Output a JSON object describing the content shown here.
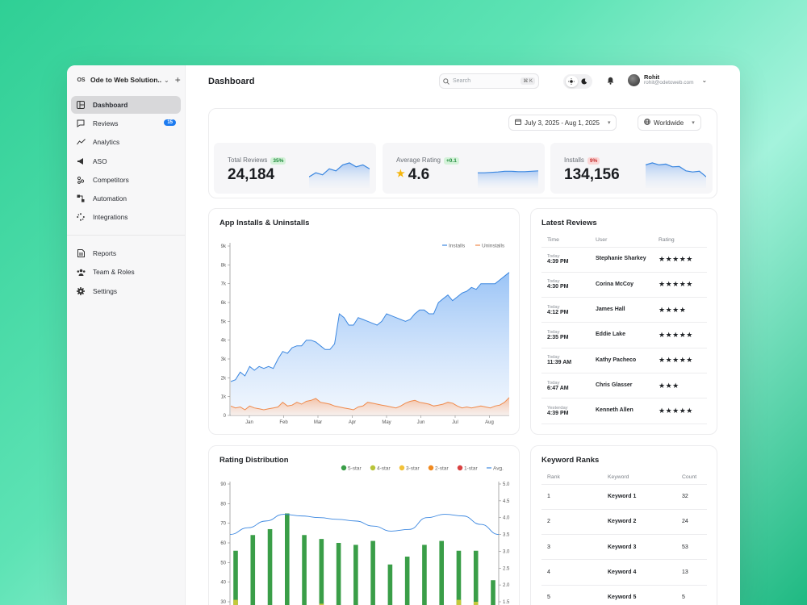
{
  "sidebar": {
    "org_badge": "OS",
    "org_name": "Ode to Web Solution...",
    "items": [
      {
        "label": "Dashboard"
      },
      {
        "label": "Reviews",
        "badge": "15"
      },
      {
        "label": "Analytics"
      },
      {
        "label": "ASO"
      },
      {
        "label": "Competitors"
      },
      {
        "label": "Automation"
      },
      {
        "label": "Integrations"
      }
    ],
    "bottom_items": [
      {
        "label": "Reports"
      },
      {
        "label": "Team & Roles"
      },
      {
        "label": "Settings"
      }
    ]
  },
  "header": {
    "title": "Dashboard",
    "search_placeholder": "Search",
    "search_shortcut": "⌘ K",
    "user_name": "Rohit",
    "user_email": "rohit@odetoweb.com"
  },
  "filters": {
    "date_range": "July 3, 2025 - Aug 1, 2025",
    "region": "Worldwide"
  },
  "stats": [
    {
      "label": "Total Reviews",
      "badge": "35%",
      "value": "24,184",
      "trend": [
        2,
        3,
        2.5,
        4,
        3.5,
        5,
        5.5,
        4.5,
        5,
        4
      ]
    },
    {
      "label": "Average Rating",
      "badge": "+0.1",
      "value": "4.6",
      "trend": [
        3,
        3,
        3.1,
        3.2,
        3.4,
        3.4,
        3.3,
        3.3,
        3.4,
        3.5
      ]
    },
    {
      "label": "Installs",
      "badge": "9%",
      "value": "134,156",
      "trend": [
        5,
        5.5,
        5,
        5.2,
        4.5,
        4.6,
        3.5,
        3.2,
        3.4,
        2
      ]
    }
  ],
  "installs_chart": {
    "title": "App Installs & Uninstalls",
    "legend": [
      "Installs",
      "Uninstalls"
    ],
    "colors": {
      "installs": "#3b87e0",
      "uninstalls": "#ef8a4c"
    },
    "y_ticks": [
      "0",
      "1k",
      "2k",
      "3k",
      "4k",
      "5k",
      "6k",
      "7k",
      "8k",
      "9k"
    ],
    "x_ticks": [
      "Jan",
      "Feb",
      "Mar",
      "Apr",
      "May",
      "Jun",
      "Jul",
      "Aug"
    ],
    "chart_data": {
      "type": "area",
      "ylim": [
        0,
        9000
      ],
      "series": [
        {
          "name": "Installs",
          "values": [
            1800,
            1900,
            2300,
            2100,
            2600,
            2400,
            2600,
            2500,
            2600,
            2500,
            3000,
            3400,
            3300,
            3600,
            3700,
            3700,
            4000,
            4000,
            3900,
            3700,
            3500,
            3500,
            3800,
            5400,
            5200,
            4800,
            4800,
            5200,
            5100,
            5000,
            4900,
            4800,
            5000,
            5400,
            5300,
            5200,
            5100,
            5000,
            5100,
            5400,
            5600,
            5600,
            5400,
            5400,
            6000,
            6200,
            6400,
            6100,
            6300,
            6500,
            6600,
            6800,
            6700,
            7000,
            7000,
            7000,
            7000,
            7200,
            7400,
            7600
          ]
        },
        {
          "name": "Uninstalls",
          "values": [
            500,
            400,
            450,
            300,
            500,
            400,
            350,
            300,
            350,
            400,
            450,
            700,
            500,
            550,
            700,
            600,
            750,
            800,
            900,
            700,
            650,
            600,
            500,
            450,
            400,
            350,
            300,
            450,
            500,
            700,
            650,
            600,
            550,
            500,
            450,
            400,
            500,
            650,
            750,
            800,
            700,
            650,
            600,
            500,
            550,
            600,
            700,
            650,
            500,
            400,
            450,
            400,
            450,
            500,
            450,
            400,
            500,
            550,
            700,
            950
          ]
        }
      ]
    }
  },
  "latest_reviews": {
    "title": "Latest Reviews",
    "columns": [
      "Time",
      "User",
      "Rating"
    ],
    "rows": [
      {
        "day": "Today",
        "time": "4:39 PM",
        "user": "Stephanie Sharkey",
        "stars": 5
      },
      {
        "day": "Today",
        "time": "4:30 PM",
        "user": "Corina McCoy",
        "stars": 5
      },
      {
        "day": "Today",
        "time": "4:12 PM",
        "user": "James Hall",
        "stars": 4
      },
      {
        "day": "Today",
        "time": "2:35 PM",
        "user": "Eddie Lake",
        "stars": 5
      },
      {
        "day": "Today",
        "time": "11:39 AM",
        "user": "Kathy Pacheco",
        "stars": 5
      },
      {
        "day": "Today",
        "time": "6:47 AM",
        "user": "Chris Glasser",
        "stars": 3
      },
      {
        "day": "Yesterday",
        "time": "4:39 PM",
        "user": "Kenneth Allen",
        "stars": 5
      }
    ]
  },
  "rating_distribution": {
    "title": "Rating Distribution",
    "legend": [
      {
        "label": "5-star",
        "color": "#3a9e48"
      },
      {
        "label": "4-star",
        "color": "#b8c43a"
      },
      {
        "label": "3-star",
        "color": "#f2c23a"
      },
      {
        "label": "2-star",
        "color": "#f0891f"
      },
      {
        "label": "1-star",
        "color": "#d94141"
      },
      {
        "label": "Avg.",
        "color": "#3b87e0"
      }
    ],
    "y_ticks": [
      "30",
      "40",
      "50",
      "60",
      "70",
      "80",
      "90"
    ],
    "y2_ticks": [
      "1.5",
      "2.0",
      "2.5",
      "3.0",
      "3.5",
      "4.0",
      "4.5",
      "5.0"
    ],
    "chart_data": {
      "type": "bar",
      "ylim": [
        25,
        90
      ],
      "y2lim": [
        1.4,
        5.0
      ],
      "series": [
        {
          "name": "5-star",
          "values": [
            56,
            64,
            67,
            75,
            64,
            62,
            60,
            59,
            61,
            49,
            53,
            59,
            61,
            56,
            56,
            41
          ]
        },
        {
          "name": "4-star",
          "values": [
            31,
            25,
            25,
            27,
            25,
            29,
            25,
            25,
            25,
            25,
            27,
            25,
            25,
            31,
            30,
            25
          ]
        },
        {
          "name": "Avg.",
          "values": [
            3.5,
            3.7,
            3.9,
            4.1,
            4.05,
            4.0,
            3.95,
            3.9,
            3.75,
            3.6,
            3.65,
            4.0,
            4.1,
            4.05,
            3.8,
            3.5
          ]
        }
      ]
    }
  },
  "keyword_ranks": {
    "title": "Keyword Ranks",
    "columns": [
      "Rank",
      "Keyword",
      "Count"
    ],
    "rows": [
      {
        "rank": "1",
        "keyword": "Keyword 1",
        "count": "32"
      },
      {
        "rank": "2",
        "keyword": "Keyword 2",
        "count": "24"
      },
      {
        "rank": "3",
        "keyword": "Keyword 3",
        "count": "53"
      },
      {
        "rank": "4",
        "keyword": "Keyword 4",
        "count": "13"
      },
      {
        "rank": "5",
        "keyword": "Keyword 5",
        "count": "5"
      }
    ]
  }
}
